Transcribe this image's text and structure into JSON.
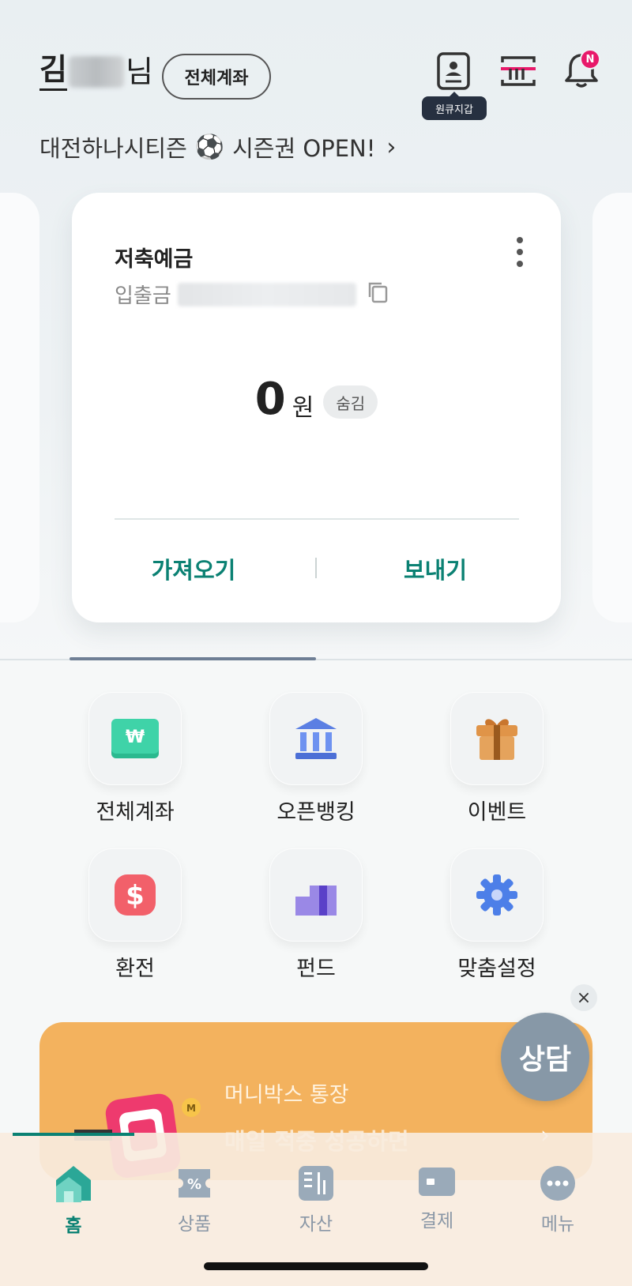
{
  "header": {
    "name_first": "김",
    "name_suffix": "님",
    "all_accounts_label": "전체계좌",
    "notification_badge": "N",
    "wallet_tooltip": "원큐지갑"
  },
  "promo": {
    "text_before": "대전하나시티즌",
    "ball": "⚽",
    "text_after": "시즌권 OPEN!",
    "chevron": "›"
  },
  "account_card": {
    "title": "저축예금",
    "subtitle": "입출금",
    "balance": "0",
    "unit": "원",
    "hide_label": "숨김",
    "import_label": "가져오기",
    "send_label": "보내기"
  },
  "quick_menu": [
    {
      "label": "전체계좌",
      "icon": "won-card-icon"
    },
    {
      "label": "오픈뱅킹",
      "icon": "bank-icon"
    },
    {
      "label": "이벤트",
      "icon": "gift-icon"
    },
    {
      "label": "환전",
      "icon": "dollar-icon"
    },
    {
      "label": "펀드",
      "icon": "fund-chart-icon"
    },
    {
      "label": "맞춤설정",
      "icon": "gear-icon"
    }
  ],
  "ad": {
    "close": "×",
    "subtitle": "머니박스 통장",
    "main_text": "매일 적중 성공하면",
    "chevron": "›",
    "counsel_label": "상담"
  },
  "tab_bar": [
    {
      "label": "홈",
      "active": true
    },
    {
      "label": "상품",
      "active": false
    },
    {
      "label": "자산",
      "active": false
    },
    {
      "label": "결제",
      "active": false
    },
    {
      "label": "메뉴",
      "active": false
    }
  ],
  "colors": {
    "accent": "#0b8173",
    "badge": "#e8196a",
    "ad_bg": "#f3b25e",
    "counsel_bg": "#8798a7"
  }
}
